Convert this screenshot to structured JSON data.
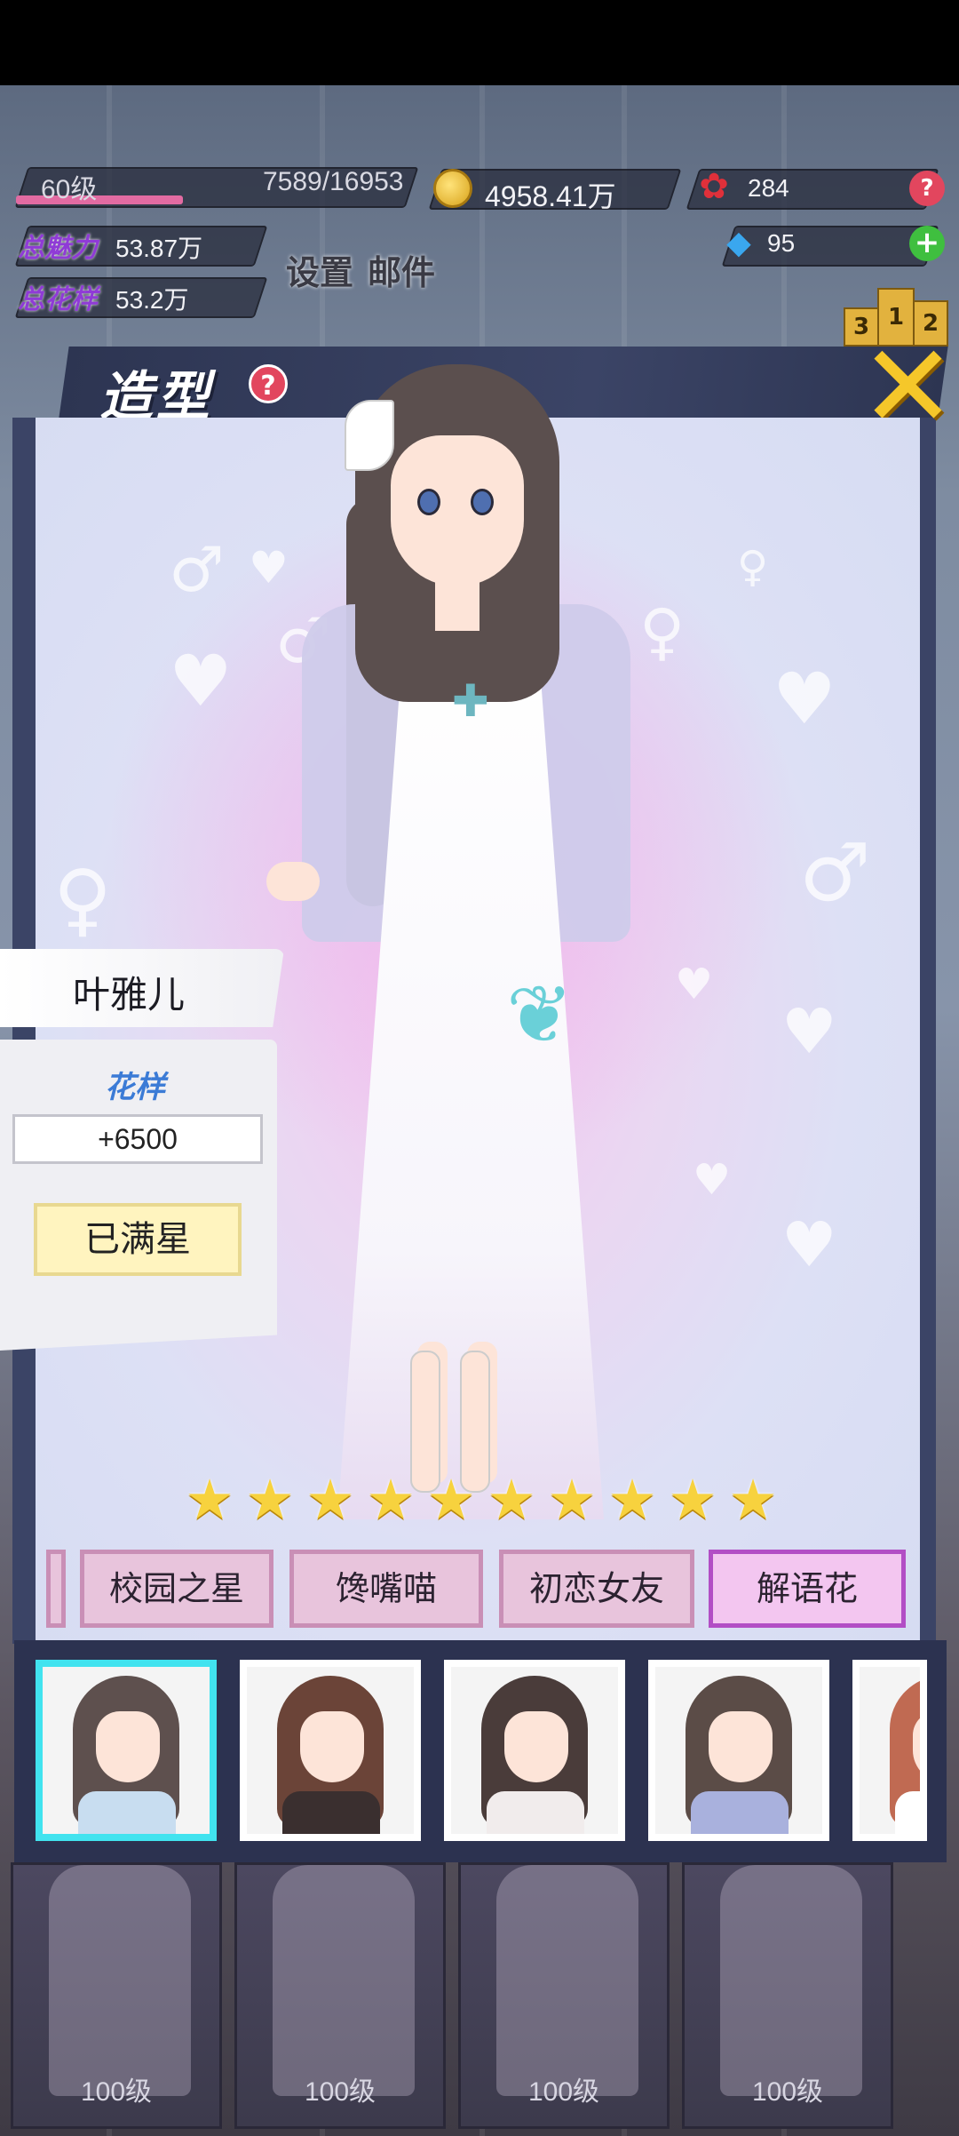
{
  "hud": {
    "level": "60级",
    "exp": "7589/16953",
    "exp_fraction": 0.448,
    "gold": "4958.41万",
    "roses": "284",
    "gems": "95",
    "total_charm_label": "总魅力",
    "total_charm_value": "53.87万",
    "total_pattern_label": "总花样",
    "total_pattern_value": "53.2万",
    "settings_label": "设置",
    "mail_label": "邮件",
    "help_glyph": "?",
    "plus_glyph": "+",
    "rank_podium": [
      "3",
      "1",
      "2"
    ]
  },
  "modal": {
    "title": "造型",
    "help_glyph": "?",
    "close_glyph": "✕"
  },
  "character": {
    "name": "叶雅儿",
    "pattern_label": "花样",
    "pattern_value": "+6500",
    "star_button": "已满星",
    "stars_filled": 10,
    "stars_total": 10
  },
  "outfits": {
    "tabs": [
      "校园之星",
      "馋嘴喵",
      "初恋女友",
      "解语花"
    ],
    "active": "解语花"
  },
  "selector": {
    "thumbs": [
      {
        "name": "thumb-1",
        "hair": "#5e504e",
        "body": "#c8ddf0",
        "selected": true
      },
      {
        "name": "thumb-2",
        "hair": "#6b4438",
        "body": "#3a2f2f",
        "selected": false
      },
      {
        "name": "thumb-3",
        "hair": "#4a3c3a",
        "body": "#f1ecec",
        "selected": false
      },
      {
        "name": "thumb-4",
        "hair": "#5b4c47",
        "body": "#a9b1dd",
        "selected": false
      },
      {
        "name": "thumb-5",
        "hair": "#c06a52",
        "body": "#ffffff",
        "selected": false
      }
    ]
  },
  "bottom_cards": [
    {
      "level": "100级"
    },
    {
      "level": "100级"
    },
    {
      "level": "100级"
    },
    {
      "level": "100级"
    }
  ],
  "colors": {
    "accent_selected": "#41e3ef",
    "tab_active_border": "#b24ec5",
    "star": "#f7d23e",
    "close": "#f5c72a"
  }
}
